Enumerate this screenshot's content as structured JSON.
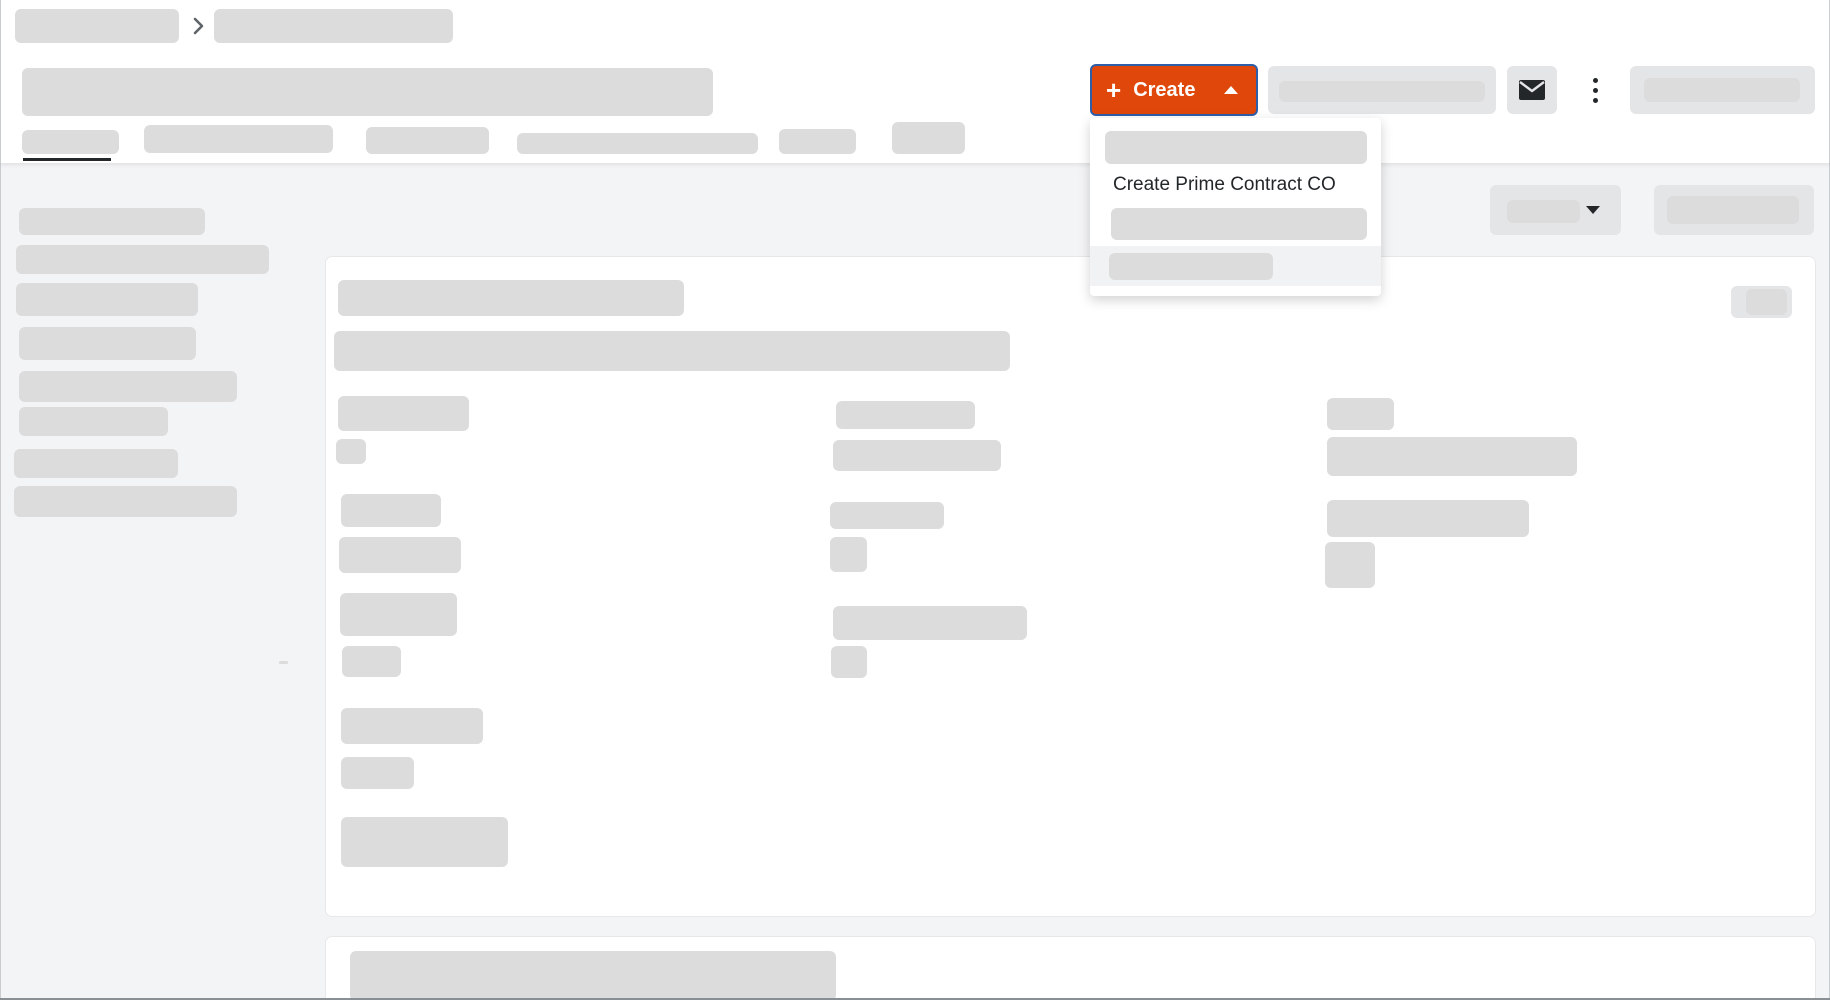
{
  "header": {
    "create_button": {
      "label": "Create",
      "icon": "plus-icon",
      "caret": "caret-up-icon",
      "color": "#e0470a"
    },
    "mail_icon": "envelope-icon",
    "more_icon": "kebab-vertical-icon"
  },
  "create_menu": {
    "items": [
      {
        "label": "Create Prime Contract CO"
      }
    ]
  },
  "colors": {
    "accent": "#e0470a",
    "focus_ring": "#2f5ea8",
    "skeleton": "#dcdcdc",
    "page_background": "#f3f4f6"
  }
}
